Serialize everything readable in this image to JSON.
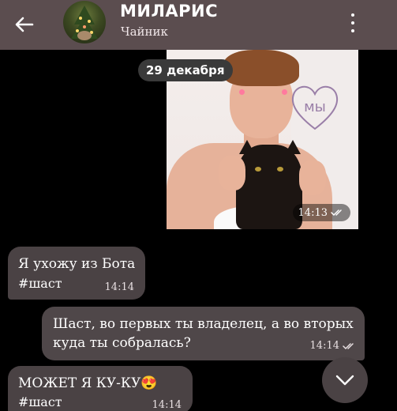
{
  "header": {
    "title": "МИЛАРИС",
    "subtitle": "Чайник",
    "back_icon": "arrow-left-icon",
    "menu_icon": "more-vertical-icon",
    "background": "#5b4d4f"
  },
  "date_separator": "29 декабря",
  "photo_message": {
    "time": "14:13",
    "status_icon": "double-check-icon",
    "heart_text": "мы"
  },
  "messages": [
    {
      "direction": "in",
      "text": "Я ухожу из Бота",
      "tag": "#шаст",
      "time": "14:14"
    },
    {
      "direction": "out",
      "text": "Шаст, во первых ты владелец, а во  вторых куда ты собралась?",
      "time": "14:14",
      "status_icon": "double-check-icon"
    },
    {
      "direction": "in",
      "text": "МОЖЕТ Я КУ-КУ😍",
      "tag": "#шаст",
      "time": "14:14"
    }
  ],
  "scroll_down_icon": "chevron-down-icon",
  "colors": {
    "bubble": "#4a4244",
    "background": "#000000"
  }
}
